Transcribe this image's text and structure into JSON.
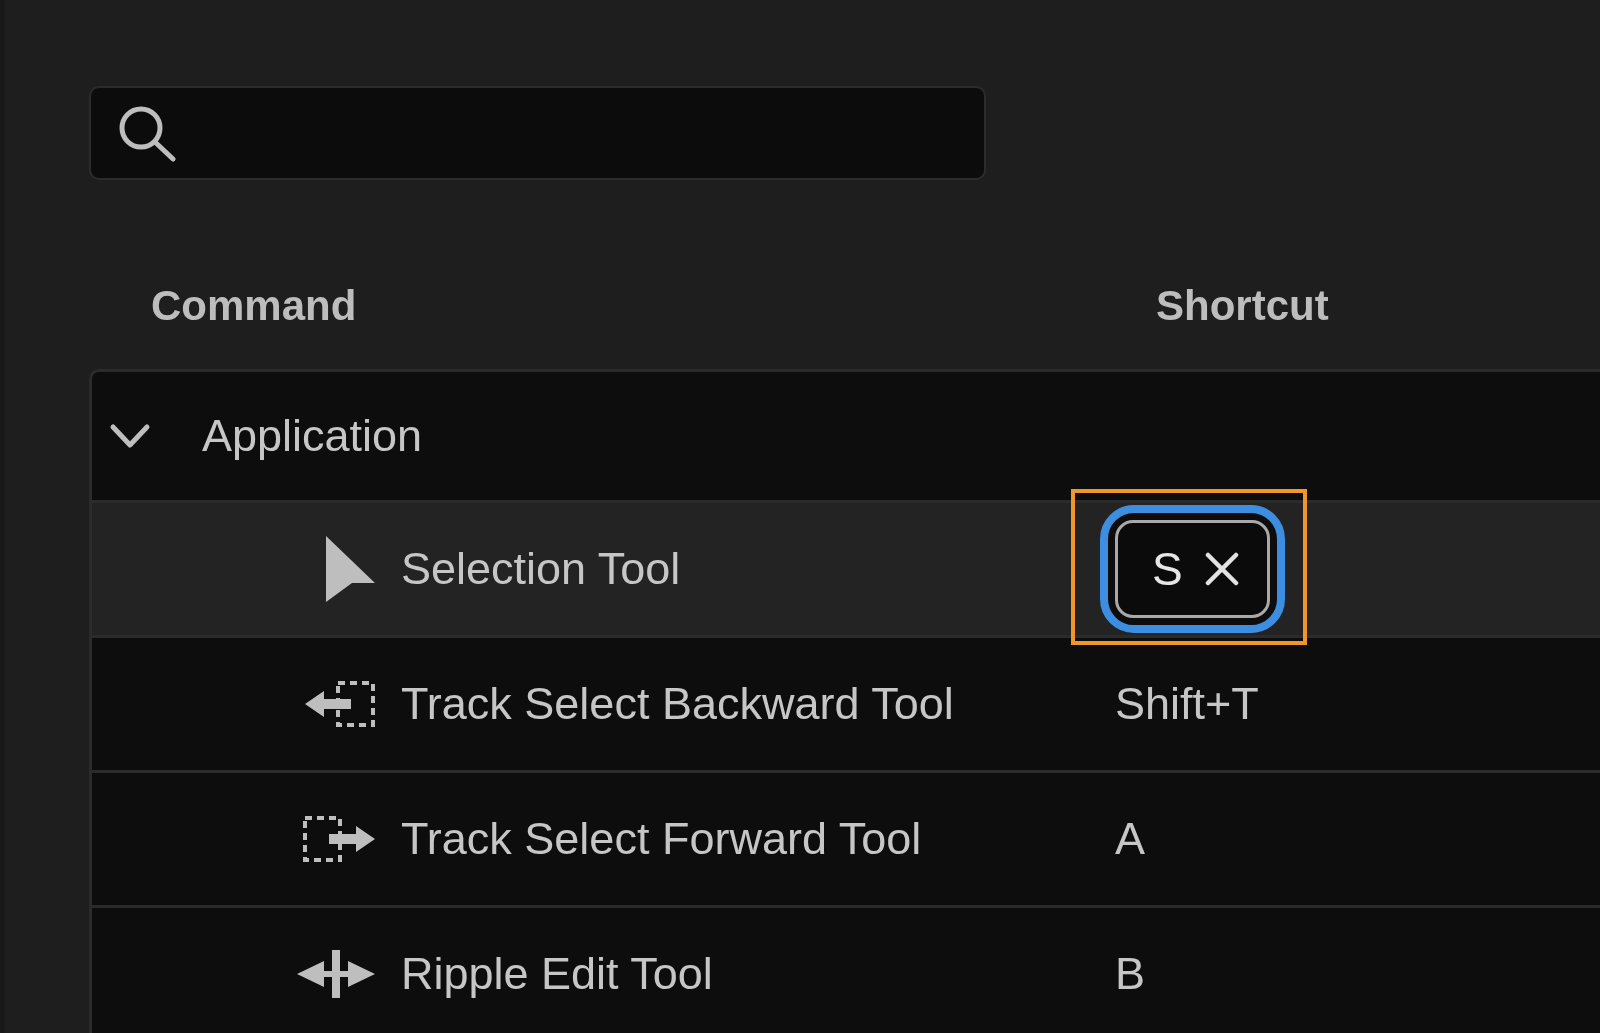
{
  "table": {
    "columns": [
      "Command",
      "Shortcut"
    ],
    "groups": [
      {
        "label": "Application",
        "expanded": true,
        "children": [
          {
            "command": "Selection Tool",
            "shortcut": "S",
            "selected": true,
            "editing": true,
            "highlighted": true
          },
          {
            "command": "Track Select Backward Tool",
            "shortcut": "Shift+T",
            "selected": false,
            "editing": false,
            "highlighted": false
          },
          {
            "command": "Track Select Forward Tool",
            "shortcut": "A",
            "selected": false,
            "editing": false,
            "highlighted": false
          },
          {
            "command": "Ripple Edit Tool",
            "shortcut": "B",
            "selected": false,
            "editing": false,
            "highlighted": false
          }
        ]
      }
    ]
  }
}
